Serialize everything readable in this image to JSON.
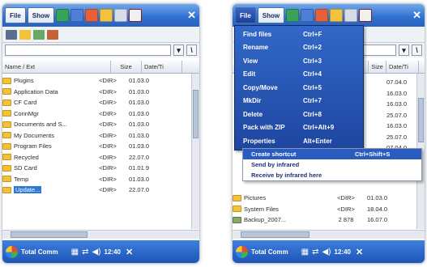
{
  "left_screen": {
    "menu": {
      "file_label": "File",
      "show_label": "Show"
    },
    "columns": {
      "name": "Name / Ext",
      "size": "Size",
      "date": "Date/Ti"
    },
    "path_button": "\\",
    "files": [
      {
        "name": "Plugins",
        "size": "<DIR>",
        "date": "01.03.0"
      },
      {
        "name": "Application Data",
        "size": "<DIR>",
        "date": "01.03.0"
      },
      {
        "name": "CF Card",
        "size": "<DIR>",
        "date": "01.03.0"
      },
      {
        "name": "ConnMgr",
        "size": "<DIR>",
        "date": "01.03.0"
      },
      {
        "name": "Documents and S...",
        "size": "<DIR>",
        "date": "01.03.0"
      },
      {
        "name": "My Documents",
        "size": "<DIR>",
        "date": "01.03.0"
      },
      {
        "name": "Program Files",
        "size": "<DIR>",
        "date": "01.03.0"
      },
      {
        "name": "Recycled",
        "size": "<DIR>",
        "date": "22.07.0"
      },
      {
        "name": "SD Card",
        "size": "<DIR>",
        "date": "01.01.9"
      },
      {
        "name": "Temp",
        "size": "<DIR>",
        "date": "01.03.0"
      },
      {
        "name": "Update...",
        "size": "<DIR>",
        "date": "22.07.0"
      }
    ],
    "taskbar": {
      "app_label": "Total Comm",
      "clock": "12:40"
    }
  },
  "right_screen": {
    "menu": {
      "file_label": "File",
      "show_label": "Show"
    },
    "path_button": "\\",
    "columns": {
      "size": "Size",
      "date": "Date/Ti"
    },
    "dropdown_items": [
      {
        "label": "Find files",
        "shortcut": "Ctrl+F"
      },
      {
        "label": "Rename",
        "shortcut": "Ctrl+2"
      },
      {
        "label": "View",
        "shortcut": "Ctrl+3"
      },
      {
        "label": "Edit",
        "shortcut": "Ctrl+4"
      },
      {
        "label": "Copy/Move",
        "shortcut": "Ctrl+5"
      },
      {
        "label": "MkDir",
        "shortcut": "Ctrl+7"
      },
      {
        "label": "Delete",
        "shortcut": "Ctrl+8"
      },
      {
        "label": "Pack with ZIP",
        "shortcut": "Ctrl+Alt+9"
      },
      {
        "label": "Properties",
        "shortcut": "Alt+Enter"
      }
    ],
    "submenu_items": [
      {
        "label": "Create shortcut",
        "shortcut": "Ctrl+Shift+S"
      },
      {
        "label": "Send by infrared",
        "shortcut": ""
      },
      {
        "label": "Receive by infrared here",
        "shortcut": ""
      }
    ],
    "bg_files": [
      {
        "name": "Pictures",
        "size": "<DIR>",
        "date": "01.03.0"
      },
      {
        "name": "System Files",
        "size": "<DIR>",
        "date": "18.04.0"
      },
      {
        "name": "Backup_2007...",
        "size": "2 878",
        "date": "16.07.0"
      }
    ],
    "right_dates": [
      "07.04.0",
      "16.03.0",
      "16.03.0",
      "25.07.0",
      "16.03.0",
      "25.07.0",
      "07.04.0"
    ],
    "taskbar": {
      "app_label": "Total Comm",
      "clock": "12:40"
    }
  },
  "colors": {
    "title_bar": "#2d6fd0",
    "menu_blue": "#1e46a0",
    "folder_yellow": "#f2c23a",
    "selection": "#2f78d6"
  },
  "icons": [
    "start-icon",
    "folder-icon",
    "close-icon",
    "speaker-icon",
    "network-icon"
  ]
}
